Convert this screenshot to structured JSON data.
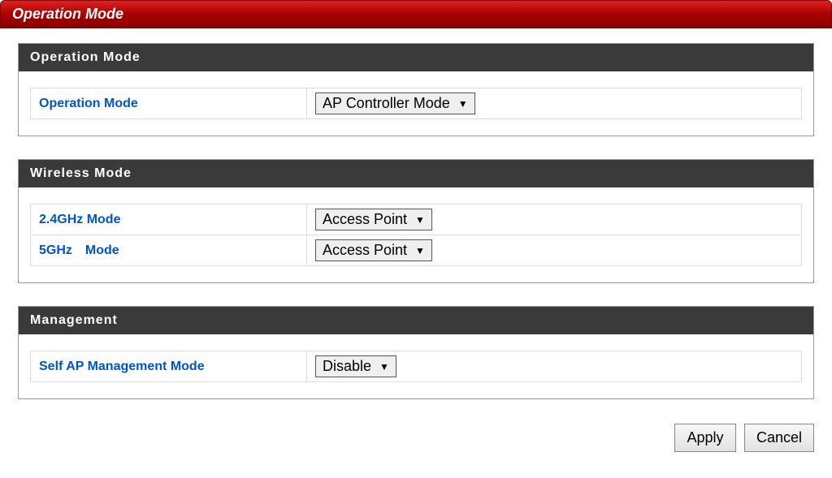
{
  "title": "Operation Mode",
  "sections": {
    "operation_mode": {
      "header": "Operation Mode",
      "rows": {
        "operation_mode": {
          "label": "Operation Mode",
          "value": "AP Controller Mode"
        }
      }
    },
    "wireless_mode": {
      "header": "Wireless Mode",
      "rows": {
        "mode_24": {
          "label": "2.4GHz Mode",
          "value": "Access Point"
        },
        "mode_5": {
          "label": "5GHz Mode",
          "value": "Access Point"
        }
      }
    },
    "management": {
      "header": "Management",
      "rows": {
        "self_ap": {
          "label": "Self AP Management Mode",
          "value": "Disable"
        }
      }
    }
  },
  "buttons": {
    "apply": "Apply",
    "cancel": "Cancel"
  }
}
